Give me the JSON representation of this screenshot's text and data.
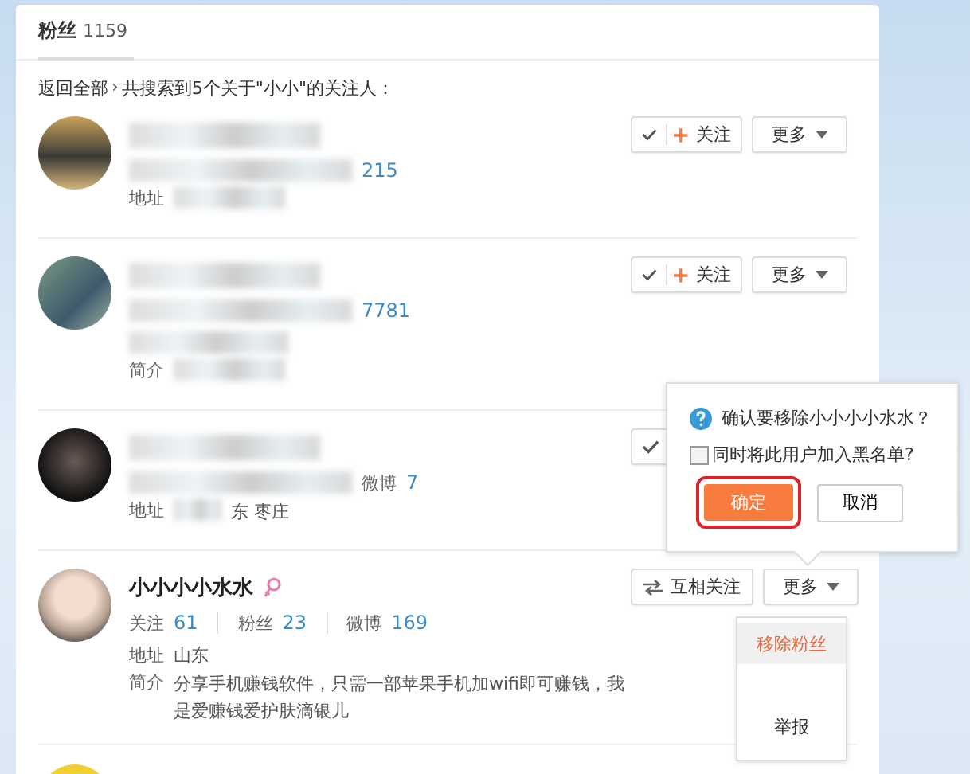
{
  "header": {
    "title": "粉丝",
    "count": "1159"
  },
  "breadcrumb": {
    "back": "返回全部",
    "separator": "›",
    "summary": "共搜索到5个关于\"小小\"的关注人："
  },
  "fans": [
    {
      "kind": "full",
      "lines": [
        {
          "kind": "name",
          "parts": [
            {
              "kind": "blur"
            }
          ]
        },
        {
          "kind": "stats",
          "parts": [
            {
              "kind": "blur"
            },
            {
              "kind": "value",
              "text": "215"
            }
          ]
        },
        {
          "kind": "info",
          "parts": [
            {
              "kind": "label",
              "text": "地址"
            },
            {
              "kind": "blur"
            }
          ]
        }
      ],
      "actions": [
        {
          "kind": "follow",
          "label": "关注"
        },
        {
          "kind": "more",
          "label": "更多"
        }
      ]
    },
    {
      "kind": "full",
      "lines": [
        {
          "kind": "name",
          "parts": [
            {
              "kind": "blur"
            }
          ]
        },
        {
          "kind": "stats",
          "parts": [
            {
              "kind": "blur"
            },
            {
              "kind": "value",
              "text": "7781"
            }
          ]
        },
        {
          "kind": "info",
          "parts": [
            {
              "kind": "blur"
            }
          ]
        },
        {
          "kind": "info",
          "parts": [
            {
              "kind": "label",
              "text": "简介"
            },
            {
              "kind": "blur"
            }
          ]
        }
      ],
      "actions": [
        {
          "kind": "follow",
          "label": "关注"
        },
        {
          "kind": "more",
          "label": "更多"
        }
      ]
    },
    {
      "kind": "full",
      "lines": [
        {
          "kind": "name",
          "parts": [
            {
              "kind": "blur"
            }
          ]
        },
        {
          "kind": "stats",
          "parts": [
            {
              "kind": "blur"
            },
            {
              "kind": "label",
              "text": "微博"
            },
            {
              "kind": "value",
              "text": "7"
            }
          ]
        },
        {
          "kind": "info",
          "parts": [
            {
              "kind": "label",
              "text": "地址"
            },
            {
              "kind": "blur"
            },
            {
              "kind": "text",
              "text": "东 枣庄"
            }
          ]
        }
      ],
      "actions": [
        {
          "kind": "follow"
        }
      ]
    },
    {
      "kind": "full",
      "lines": [
        {
          "kind": "name",
          "parts": [
            {
              "kind": "name",
              "text": "小小小小水水"
            },
            {
              "kind": "female"
            }
          ]
        },
        {
          "kind": "stats",
          "parts": [
            {
              "kind": "label",
              "text": "关注"
            },
            {
              "kind": "value",
              "text": "61"
            },
            {
              "kind": "sep"
            },
            {
              "kind": "label",
              "text": "粉丝"
            },
            {
              "kind": "value",
              "text": "23"
            },
            {
              "kind": "sep"
            },
            {
              "kind": "label",
              "text": "微博"
            },
            {
              "kind": "value",
              "text": "169"
            }
          ]
        },
        {
          "kind": "info",
          "parts": [
            {
              "kind": "label",
              "text": "地址"
            },
            {
              "kind": "text",
              "text": "山东"
            }
          ]
        },
        {
          "kind": "info",
          "parts": [
            {
              "kind": "label",
              "text": "简介"
            },
            {
              "kind": "text",
              "text": "分享手机赚钱软件，只需一部苹果手机加wifi即可赚钱，我是爱赚钱爱护肤滴银儿"
            }
          ]
        }
      ],
      "actions": [
        {
          "kind": "mutual",
          "label": "互相关注"
        },
        {
          "kind": "more",
          "label": "更多"
        }
      ]
    },
    {
      "kind": "partial"
    }
  ],
  "confirm_popup": {
    "question": "确认要移除小小小小水水？",
    "checkbox": {
      "label": "同时将此用户加入黑名单?",
      "checked": false
    },
    "confirm": {
      "label": "确定",
      "highlighted": true
    },
    "cancel": "取消"
  },
  "more_menu": {
    "items": [
      {
        "label": "移除粉丝",
        "selected": true
      },
      {
        "label": "举报",
        "selected": false
      }
    ]
  }
}
